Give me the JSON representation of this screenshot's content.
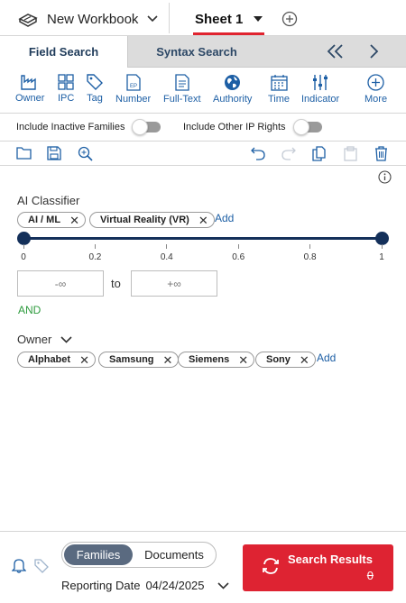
{
  "topbar": {
    "workbook_label": "New Workbook",
    "sheet_label": "Sheet 1"
  },
  "tabs": {
    "active": "Field Search",
    "inactive": "Syntax Search"
  },
  "fields": [
    {
      "label": "Owner",
      "icon": "factory-icon"
    },
    {
      "label": "IPC",
      "icon": "grid-icon"
    },
    {
      "label": "Tag",
      "icon": "tag-icon"
    },
    {
      "label": "Number",
      "icon": "document-ep-icon"
    },
    {
      "label": "Full-Text",
      "icon": "text-document-icon"
    },
    {
      "label": "Authority",
      "icon": "globe-icon"
    },
    {
      "label": "Time",
      "icon": "calendar-icon"
    },
    {
      "label": "Indicator",
      "icon": "sliders-icon"
    },
    {
      "label": "More",
      "icon": "plus-circle-icon"
    }
  ],
  "toggles": {
    "inactive_families": "Include Inactive Families",
    "other_ip_rights": "Include Other IP Rights"
  },
  "ai_classifier": {
    "label": "AI Classifier",
    "chips": [
      "AI / ML",
      "Virtual Reality (VR)"
    ],
    "add_label": "Add",
    "ticks": [
      "0",
      "0.2",
      "0.4",
      "0.6",
      "0.8",
      "1"
    ],
    "range": {
      "min": 0,
      "max": 1
    },
    "from_placeholder": "-∞",
    "to_label": "to",
    "to_placeholder": "+∞"
  },
  "and_label": "AND",
  "owner": {
    "label": "Owner",
    "chips": [
      "Alphabet",
      "Samsung",
      "Siemens",
      "Sony"
    ],
    "add_label": "Add"
  },
  "bottom": {
    "segment_on": "Families",
    "segment_off": "Documents",
    "reporting_label": "Reporting Date",
    "reporting_date": "04/24/2025",
    "search_label": "Search Results",
    "search_count": "0"
  },
  "colors": {
    "accent_red": "#de2332",
    "link_blue": "#1d5fa5",
    "slider_navy": "#14305a",
    "and_green": "#2e9b3e"
  }
}
